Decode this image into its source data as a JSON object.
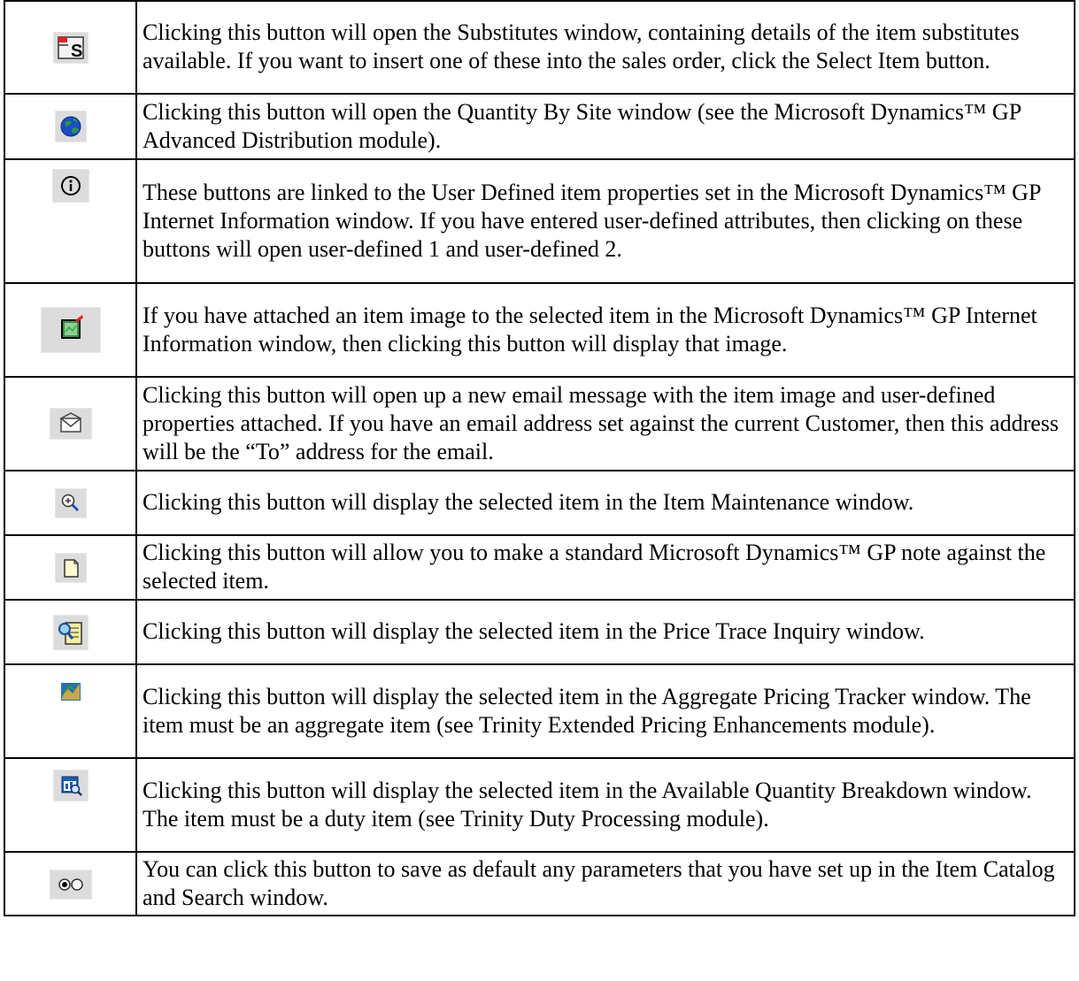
{
  "rows": [
    {
      "icon": "substitutes-icon",
      "text": "Clicking this button will open the Substitutes window, containing details of the item substitutes available. If you want to insert one of these into the sales order, click the Select Item button."
    },
    {
      "icon": "globe-icon",
      "text": "Clicking this button will open the Quantity By Site window (see the Microsoft Dynamics™ GP Advanced Distribution module)."
    },
    {
      "icon": "info-icon",
      "text": "These buttons are linked to the User Defined item properties set in the Microsoft Dynamics™ GP Internet Information window. If you have entered user-defined attributes, then clicking on these buttons will open user-defined 1 and user-defined 2."
    },
    {
      "icon": "image-icon",
      "text": "If you have attached an item image to the selected item in the Microsoft Dynamics™ GP Internet Information window, then clicking this button will display that image."
    },
    {
      "icon": "email-icon",
      "text": "Clicking this button will open up a new email message with the item image and user-defined properties attached. If you have an email address set against the current Customer, then this address will be the “To” address for the email."
    },
    {
      "icon": "zoom-icon",
      "text": "Clicking this button will display the selected item in the Item Maintenance window."
    },
    {
      "icon": "note-icon",
      "text": "Clicking this button will allow you to make a standard Microsoft Dynamics™ GP note against the selected item."
    },
    {
      "icon": "price-trace-icon",
      "text": "Clicking this button will display the selected item in the Price Trace Inquiry window."
    },
    {
      "icon": "aggregate-pricing-icon",
      "text": "Clicking this button will display the selected item in the Aggregate Pricing Tracker window. The item must be an aggregate item (see Trinity Extended Pricing Enhancements module)."
    },
    {
      "icon": "available-quantity-icon",
      "text": "Clicking this button will display the selected item in the Available Quantity Breakdown window. The item must be a duty item (see Trinity Duty Processing module)."
    },
    {
      "icon": "save-defaults-icon",
      "text": "You can click this button to save as default any parameters that you have set up in the Item Catalog and Search window."
    }
  ]
}
